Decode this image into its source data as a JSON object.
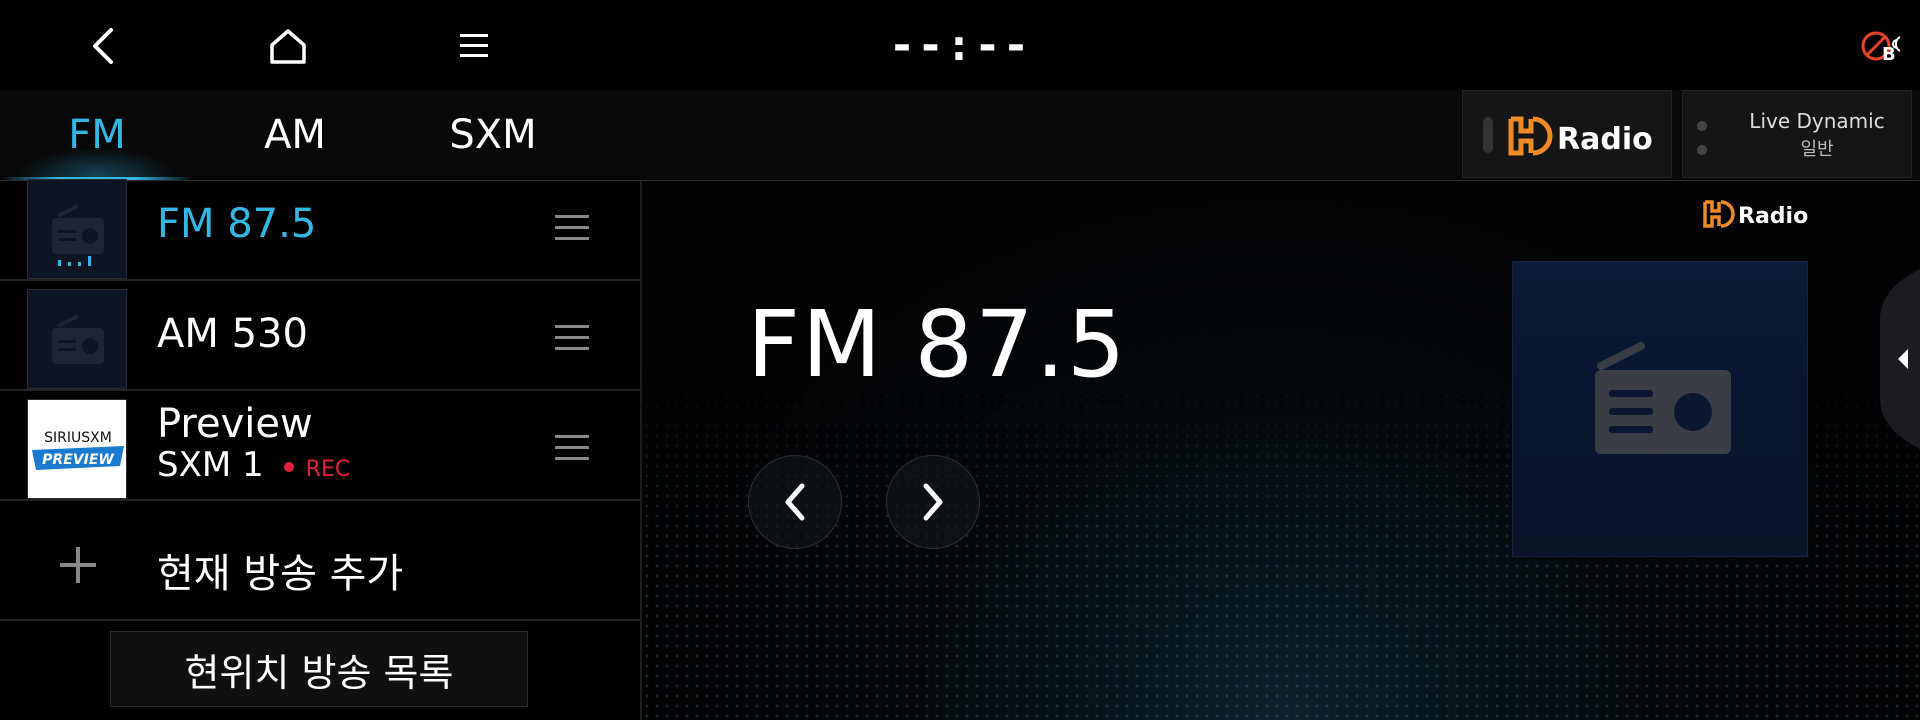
{
  "header": {
    "clock": "--:--"
  },
  "tabs": [
    {
      "label": "FM",
      "active": true
    },
    {
      "label": "AM",
      "active": false
    },
    {
      "label": "SXM",
      "active": false
    }
  ],
  "hd_radio_button": {
    "logo_text": "Radio",
    "logo_prefix": "HD"
  },
  "sound_button": {
    "line1": "Live Dynamic",
    "line2": "일반"
  },
  "presets": [
    {
      "title": "FM 87.5",
      "active": true
    },
    {
      "title": "AM 530",
      "active": false
    },
    {
      "title_line1": "Preview",
      "title_line2": "SXM 1",
      "rec_label": "REC",
      "thumb_text1": "SIRIUSXM",
      "thumb_text2": "PREVIEW"
    }
  ],
  "add_current_label": "현재 방송 추가",
  "nearby_list_label": "현위치 방송 목록",
  "now_playing": {
    "station": "FM 87.5",
    "hd_logo_text": "Radio",
    "hd_logo_prefix": "HD"
  },
  "colors": {
    "accent": "#33b8e6",
    "rec": "#e0223a",
    "hd_orange": "#f08a24"
  },
  "icons": [
    "back-icon",
    "home-icon",
    "menu-icon",
    "bluetooth-off-icon",
    "prev-icon",
    "next-icon",
    "drag-handle-icon",
    "plus-icon",
    "radio-icon"
  ]
}
